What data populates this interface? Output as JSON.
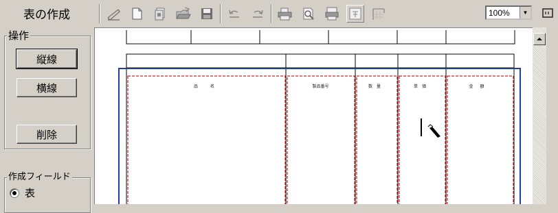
{
  "panel": {
    "title": "表の作成",
    "ops_group_label": "操作",
    "btn_vertical": "縦線",
    "btn_horizontal": "横線",
    "btn_delete": "削除",
    "field_group_label": "作成フィールド",
    "radio_table": "表"
  },
  "toolbar": {
    "zoom_value": "100%",
    "icons": [
      "pencil-icon",
      "new-page-icon",
      "copy-page-icon",
      "open-folder-icon",
      "save-disk-icon",
      "undo-icon",
      "redo-icon",
      "print-icon",
      "print-preview-icon",
      "page-setup-icon",
      "text-box-icon",
      "grid-layout-icon",
      "zoom-icon"
    ]
  },
  "table": {
    "headers": [
      "品　名",
      "製品番号",
      "数量",
      "単価",
      "金額"
    ]
  },
  "colors": {
    "selection_blue": "#1f3fa0",
    "dashed_red": "#cc2020",
    "chrome": "#d4d0c8"
  }
}
